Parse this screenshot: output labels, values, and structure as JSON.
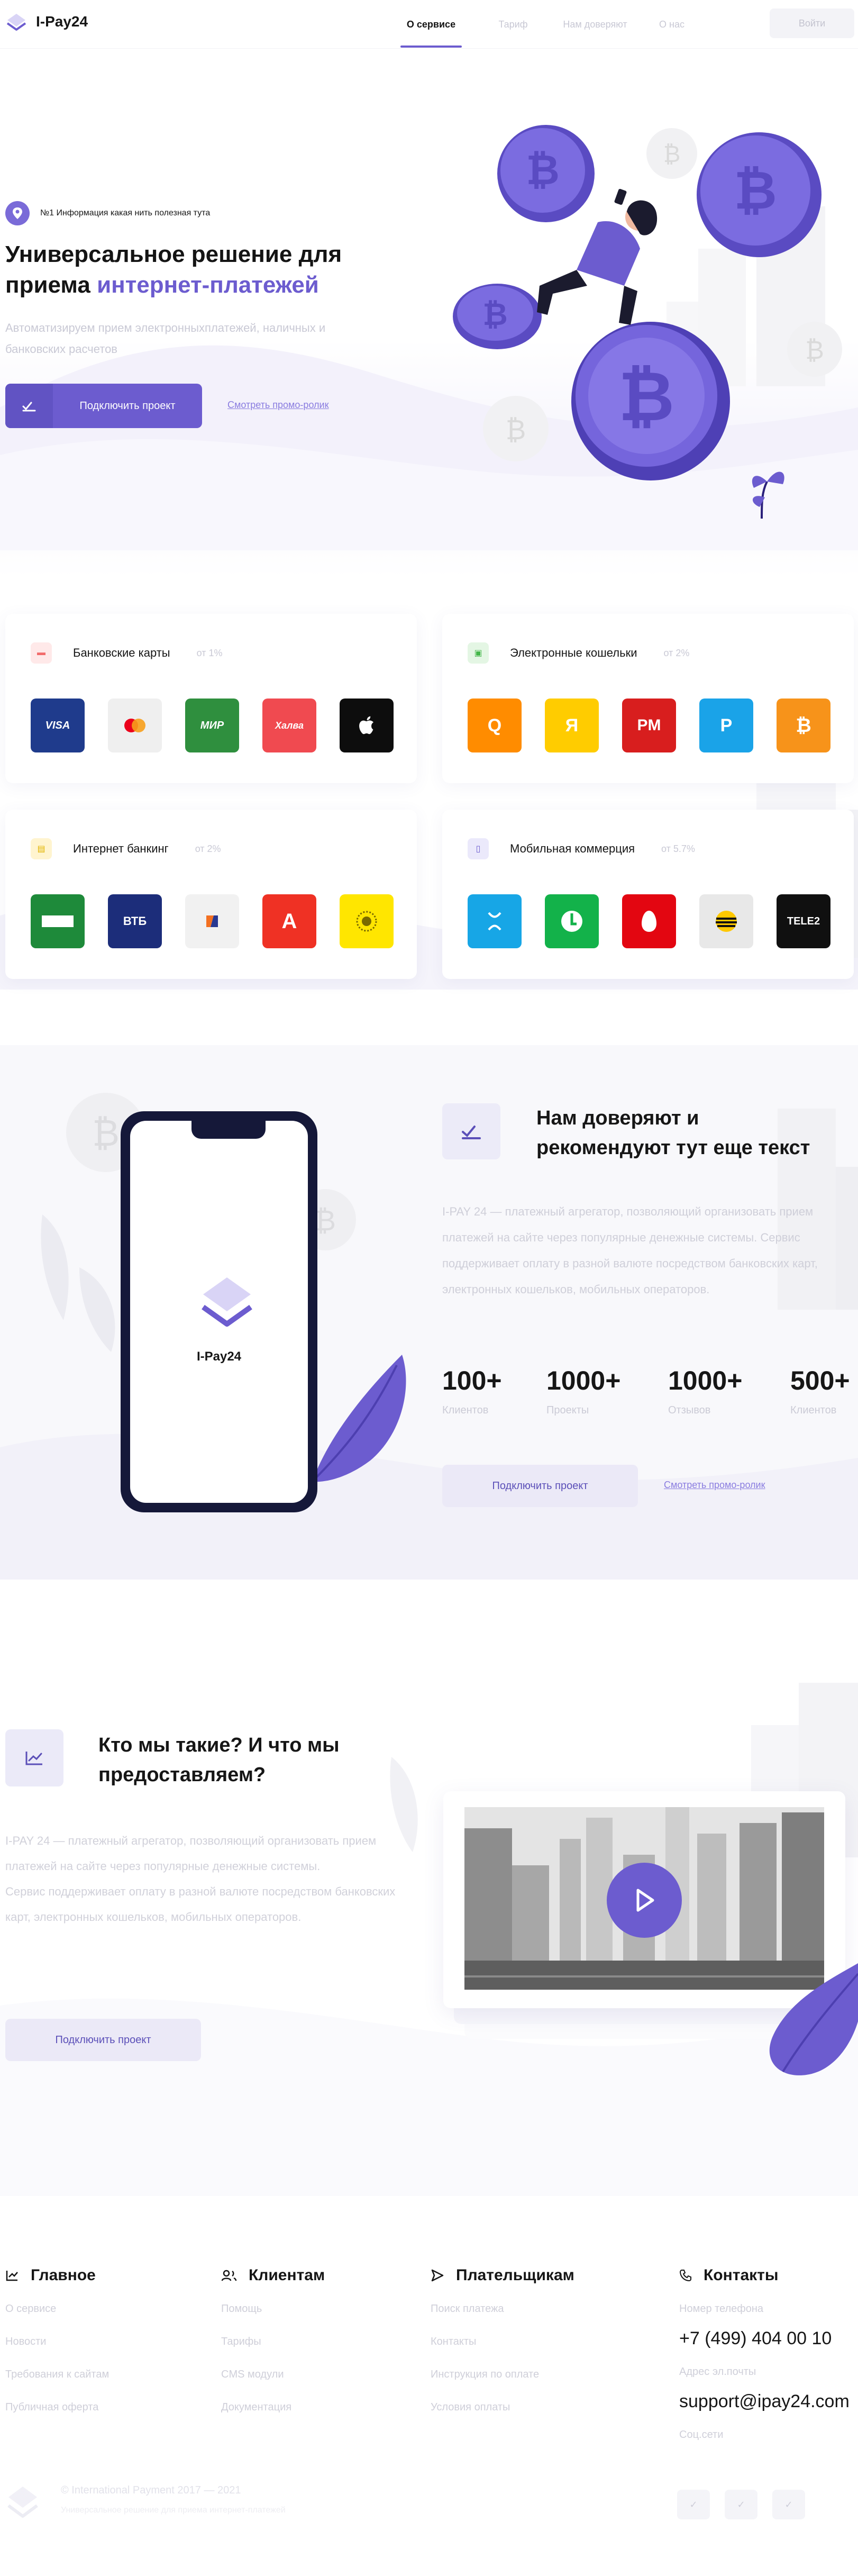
{
  "header": {
    "logo_text": "I-Pay24",
    "nav": [
      "О сервисе",
      "Тариф",
      "Нам доверяют",
      "О нас"
    ],
    "login": "Войти"
  },
  "hero": {
    "badge": "№1 Информация какая нить полезная тута",
    "title_line1": "Универсальное решение для",
    "title_line2_plain": "приема",
    "title_line2_accent": "интернет-платежей",
    "subtitle": "Автоматизируем прием электронныхплатежей, наличных и банковских расчетов",
    "cta": "Подключить проект",
    "promo_link": "Смотреть промо-ролик"
  },
  "payments": [
    {
      "title": "Банковские карты",
      "from": "от 1%",
      "icon": "card-icon",
      "icon_color": "#f26b6b",
      "icon_bg": "#ffe9e9",
      "tiles": [
        {
          "label": "VISA",
          "bg": "#1f3b8c",
          "icon": "visa-logo-icon"
        },
        {
          "label": "●●",
          "bg": "#efefef",
          "icon": "mastercard-logo-icon"
        },
        {
          "label": "МИР",
          "bg": "#2f8f3e",
          "icon": "mir-logo-icon"
        },
        {
          "label": "Халва",
          "bg": "#f04a50",
          "icon": "halva-logo-icon"
        },
        {
          "label": "",
          "bg": "#0d0d0d",
          "icon": "apple-logo-icon"
        }
      ]
    },
    {
      "title": "Электронные кошельки",
      "from": "от 2%",
      "icon": "wallet-icon",
      "icon_color": "#43b649",
      "icon_bg": "#e4f6e4",
      "tiles": [
        {
          "label": "Q",
          "bg": "#ff8c00",
          "icon": "qiwi-logo-icon"
        },
        {
          "label": "Я",
          "bg": "#ffcc00",
          "icon": "yoomoney-logo-icon"
        },
        {
          "label": "PM",
          "bg": "#d81e1e",
          "icon": "perfectmoney-logo-icon"
        },
        {
          "label": "P",
          "bg": "#1aa3e8",
          "icon": "payeer-logo-icon"
        },
        {
          "label": "₿",
          "bg": "#f7931a",
          "icon": "bitcoin-logo-icon"
        }
      ]
    },
    {
      "title": "Интернет банкинг",
      "from": "от 2%",
      "icon": "bank-icon",
      "icon_color": "#e2b400",
      "icon_bg": "#fff4cf",
      "tiles": [
        {
          "label": "",
          "bg": "#1e8a3a",
          "icon": "sber-logo-icon"
        },
        {
          "label": "ВТБ",
          "bg": "#1c2d7a",
          "icon": "vtb-logo-icon"
        },
        {
          "label": "",
          "bg": "#f1f1f1",
          "icon": "psb-logo-icon"
        },
        {
          "label": "А",
          "bg": "#ef3124",
          "icon": "alfa-logo-icon"
        },
        {
          "label": "",
          "bg": "#ffe600",
          "icon": "raiffeisen-logo-icon"
        }
      ]
    },
    {
      "title": "Мобильная коммерция",
      "from": "от 5.7%",
      "icon": "mobile-icon",
      "icon_color": "#6c5ccf",
      "icon_bg": "#ebe9fb",
      "tiles": [
        {
          "label": "",
          "bg": "#17a6e6",
          "icon": "yota-logo-icon"
        },
        {
          "label": "",
          "bg": "#13b24a",
          "icon": "megafon-logo-icon"
        },
        {
          "label": "",
          "bg": "#e30611",
          "icon": "mts-logo-icon"
        },
        {
          "label": "",
          "bg": "#e8e8e8",
          "icon": "beeline-logo-icon"
        },
        {
          "label": "TELE2",
          "bg": "#101010",
          "icon": "tele2-logo-icon"
        }
      ]
    }
  ],
  "trust": {
    "phone_label": "I-Pay24",
    "title": "Нам доверяют и рекомендуют тут еще текст",
    "text": "I-PAY 24 — платежный агрегатор, позволяющий организовать прием платежей на сайте через популярные денежные системы. Сервис поддерживает оплату в разной валюте посредством банковских карт, электронных кошельков, мобильных операторов.",
    "stats": [
      {
        "num": "100+",
        "label": "Клиентов"
      },
      {
        "num": "1000+",
        "label": "Проекты"
      },
      {
        "num": "1000+",
        "label": "Отзывов"
      },
      {
        "num": "500+",
        "label": "Клиентов"
      }
    ],
    "cta": "Подключить проект",
    "promo_link": "Смотреть промо-ролик"
  },
  "who": {
    "title": "Кто мы такие? И что мы предоставляем?",
    "text_p1": "I-PAY 24 — платежный агрегатор, позволяющий организовать прием платежей на сайте через популярные денежные системы.",
    "text_p2": "Сервис поддерживает оплату в разной валюте посредством банковских карт, электронных кошельков, мобильных операторов.",
    "cta": "Подключить проект"
  },
  "footer": {
    "main": {
      "title": "Главное",
      "links": [
        "О сервисе",
        "Новости",
        "Требования к сайтам",
        "Публичная оферта"
      ]
    },
    "clients": {
      "title": "Клиентам",
      "links": [
        "Помощь",
        "Тарифы",
        "CMS модули",
        "Документация"
      ]
    },
    "payers": {
      "title": "Плательщикам",
      "links": [
        "Поиск платежа",
        "Контакты",
        "Инструкция по оплате",
        "Условия оплаты"
      ]
    },
    "contacts": {
      "title": "Контакты",
      "phone_label": "Номер телефона",
      "phone": "+7 (499) 404 00 10",
      "email_label": "Адрес эл.почты",
      "email": "support@ipay24.com",
      "social_label": "Соц.сети"
    },
    "copyright": "© International Payment 2017 — 2021",
    "copyright_sub": "Универсальное решение для приема интернет-платежей"
  },
  "colors": {
    "accent": "#6c5ccf",
    "muted": "#c9c9d5",
    "dark": "#151839"
  }
}
